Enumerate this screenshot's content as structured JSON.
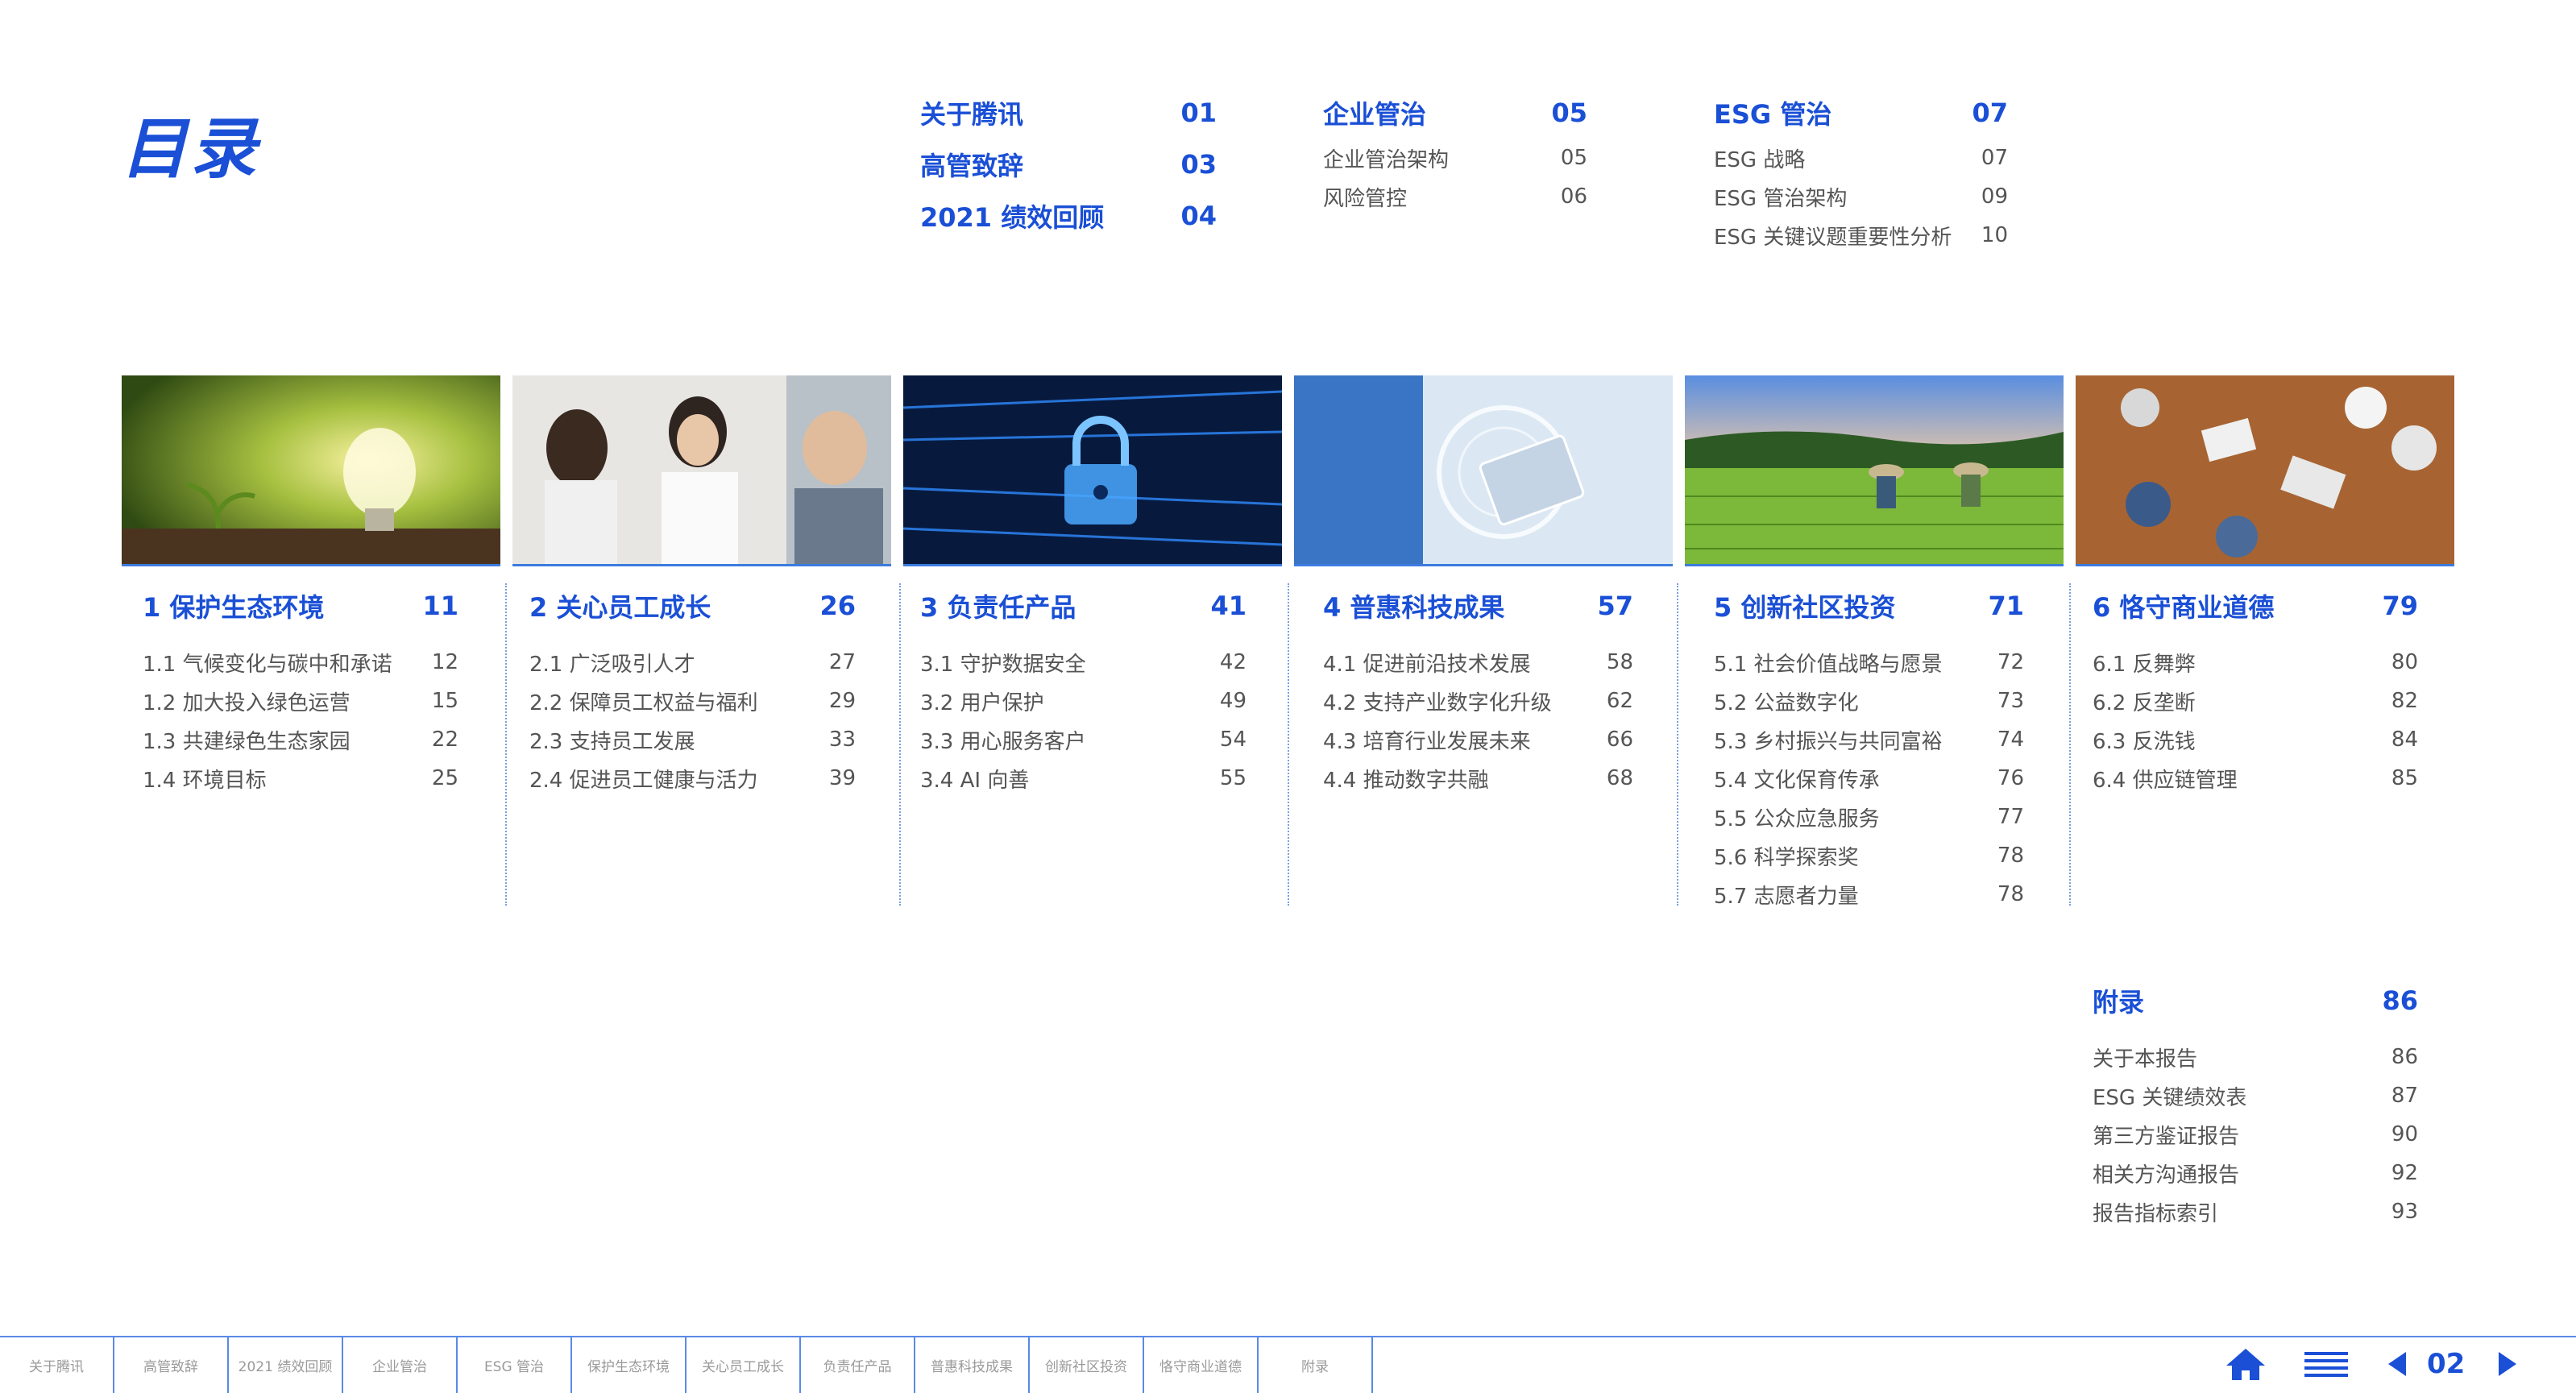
{
  "title": "目录",
  "overview": {
    "col1": [
      {
        "label": "关于腾讯",
        "page": "01"
      },
      {
        "label": "高管致辞",
        "page": "03"
      },
      {
        "label": "2021 绩效回顾",
        "page": "04"
      }
    ],
    "col2": {
      "head": {
        "label": "企业管治",
        "page": "05"
      },
      "items": [
        {
          "label": "企业管治架构",
          "page": "05"
        },
        {
          "label": "风险管控",
          "page": "06"
        }
      ]
    },
    "col3": {
      "head": {
        "label": "ESG 管治",
        "page": "07"
      },
      "items": [
        {
          "label": "ESG 战略",
          "page": "07"
        },
        {
          "label": "ESG 管治架构",
          "page": "09"
        },
        {
          "label": "ESG 关键议题重要性分析",
          "page": "10"
        }
      ]
    }
  },
  "sections": [
    {
      "title": "1 保护生态环境",
      "page": "11",
      "items": [
        {
          "label": "1.1 气候变化与碳中和承诺",
          "page": "12"
        },
        {
          "label": "1.2 加大投入绿色运营",
          "page": "15"
        },
        {
          "label": "1.3 共建绿色生态家园",
          "page": "22"
        },
        {
          "label": "1.4 环境目标",
          "page": "25"
        }
      ]
    },
    {
      "title": "2 关心员工成长",
      "page": "26",
      "items": [
        {
          "label": "2.1 广泛吸引人才",
          "page": "27"
        },
        {
          "label": "2.2 保障员工权益与福利",
          "page": "29"
        },
        {
          "label": "2.3 支持员工发展",
          "page": "33"
        },
        {
          "label": "2.4 促进员工健康与活力",
          "page": "39"
        }
      ]
    },
    {
      "title": "3 负责任产品",
      "page": "41",
      "items": [
        {
          "label": "3.1 守护数据安全",
          "page": "42"
        },
        {
          "label": "3.2 用户保护",
          "page": "49"
        },
        {
          "label": "3.3 用心服务客户",
          "page": "54"
        },
        {
          "label": "3.4 AI 向善",
          "page": "55"
        }
      ]
    },
    {
      "title": "4 普惠科技成果",
      "page": "57",
      "items": [
        {
          "label": "4.1 促进前沿技术发展",
          "page": "58"
        },
        {
          "label": "4.2 支持产业数字化升级",
          "page": "62"
        },
        {
          "label": "4.3 培育行业发展未来",
          "page": "66"
        },
        {
          "label": "4.4 推动数字共融",
          "page": "68"
        }
      ]
    },
    {
      "title": "5 创新社区投资",
      "page": "71",
      "items": [
        {
          "label": "5.1 社会价值战略与愿景",
          "page": "72"
        },
        {
          "label": "5.2 公益数字化",
          "page": "73"
        },
        {
          "label": "5.3 乡村振兴与共同富裕",
          "page": "74"
        },
        {
          "label": "5.4 文化保育传承",
          "page": "76"
        },
        {
          "label": "5.5 公众应急服务",
          "page": "77"
        },
        {
          "label": "5.6 科学探索奖",
          "page": "78"
        },
        {
          "label": "5.7 志愿者力量",
          "page": "78"
        }
      ]
    },
    {
      "title": "6 恪守商业道德",
      "page": "79",
      "items": [
        {
          "label": "6.1 反舞弊",
          "page": "80"
        },
        {
          "label": "6.2 反垄断",
          "page": "82"
        },
        {
          "label": "6.3 反洗钱",
          "page": "84"
        },
        {
          "label": "6.4 供应链管理",
          "page": "85"
        }
      ]
    }
  ],
  "appendix": {
    "title": "附录",
    "page": "86",
    "items": [
      {
        "label": "关于本报告",
        "page": "86"
      },
      {
        "label": "ESG 关键绩效表",
        "page": "87"
      },
      {
        "label": "第三方鉴证报告",
        "page": "90"
      },
      {
        "label": "相关方沟通报告",
        "page": "92"
      },
      {
        "label": "报告指标索引",
        "page": "93"
      }
    ]
  },
  "nav_tabs": [
    "关于腾讯",
    "高管致辞",
    "2021 绩效回顾",
    "企业管治",
    "ESG 管治",
    "保护生态环境",
    "关心员工成长",
    "负责任产品",
    "普惠科技成果",
    "创新社区投资",
    "恪守商业道德",
    "附录"
  ],
  "current_page": "02",
  "icons": {
    "home": "home-icon",
    "menu": "menu-icon",
    "prev": "prev-arrow-icon",
    "next": "next-arrow-icon"
  },
  "colors": {
    "accent": "#1a4fd6",
    "text": "#555555",
    "divider": "#7a9fe0"
  }
}
